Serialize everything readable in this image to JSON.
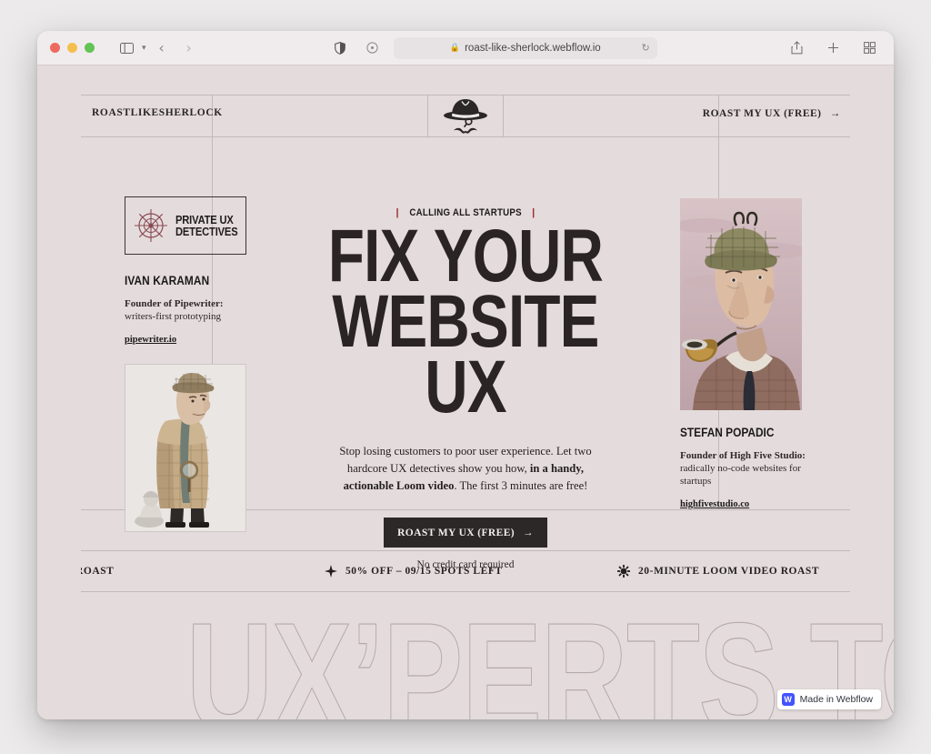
{
  "browser": {
    "url": "roast-like-sherlock.webflow.io",
    "lock_icon": "lock-icon",
    "reload_icon": "reload-icon",
    "sidebar_icon": "sidebar-toggle-icon",
    "back_icon": "back-arrow-icon",
    "forward_icon": "forward-arrow-icon",
    "shield_icon": "privacy-shield-icon",
    "extension_icon": "extension-icon",
    "share_icon": "share-icon",
    "newtab_icon": "new-tab-icon",
    "tabs_icon": "tab-overview-icon"
  },
  "nav": {
    "brand": "ROASTLIKESHERLOCK",
    "logo_icon": "detective-hat-logo",
    "cta_label": "ROAST MY UX (FREE)",
    "cta_arrow": "→"
  },
  "left": {
    "badge_line1": "PRIVATE UX",
    "badge_line2": "DETECTIVES",
    "badge_icon": "compass-crosshair-icon",
    "name": "IVAN KARAMAN",
    "role_bold": "Founder of Pipewriter:",
    "role_rest": "writers-first prototyping",
    "link": "pipewriter.io",
    "illustration": "sherlock-full-body-illustration"
  },
  "hero": {
    "eyebrow": "CALLING ALL STARTUPS",
    "eyebrow_pipe": "|",
    "headline_line1": "FIX YOUR",
    "headline_line2": "WEBSITE UX",
    "lede_part1": "Stop losing customers to poor user experience. Let two hardcore UX detectives show you how, ",
    "lede_bold": "in a handy, actionable Loom video",
    "lede_part2": ". The first 3 minutes are free!",
    "cta_label": "ROAST MY UX (FREE)",
    "cta_arrow": "→",
    "note": "No credit card required"
  },
  "right": {
    "name": "STEFAN POPADIC",
    "role_bold": "Founder of High Five Studio:",
    "role_rest": "radically no-code websites for startups",
    "link": "highfivestudio.co",
    "illustration": "sherlock-portrait-pipe-illustration"
  },
  "ticker": {
    "item1": "DEO ROAST",
    "item2": "50% OFF – 09/15 SPOTS LEFT",
    "item2_icon": "compass-star-icon",
    "item3": "20-MINUTE LOOM VIDEO ROAST",
    "item3_icon": "sun-burst-icon"
  },
  "outline_text": "UX’PERTS TO THE",
  "webflow_badge": {
    "label": "Made in Webflow",
    "icon": "webflow-logo-icon"
  },
  "colors": {
    "page_bg": "#e4dcdc",
    "ink": "#2a2424",
    "accent_red": "#9c2b2b",
    "rule": "#c2b9ba",
    "outline_stroke": "#b5a9ab",
    "webflow_blue": "#4353ff"
  }
}
